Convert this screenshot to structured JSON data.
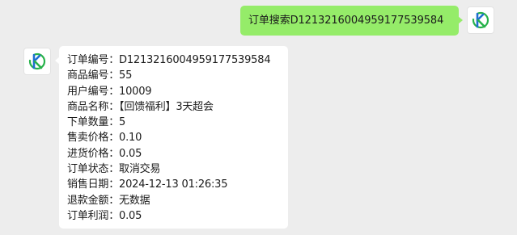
{
  "chat": {
    "outgoing": {
      "text": "订单搜索D1213216004959177539584"
    },
    "reply": {
      "lines": [
        {
          "label": "订单编号：",
          "value": "D1213216004959177539584"
        },
        {
          "label": "商品编号：",
          "value": "55"
        },
        {
          "label": "用户编号：",
          "value": "10009"
        },
        {
          "label": "商品名称：",
          "value": "【回馈福利】3天超会"
        },
        {
          "label": "下单数量：",
          "value": "5"
        },
        {
          "label": "售卖价格：",
          "value": "0.10"
        },
        {
          "label": "进货价格：",
          "value": "0.05"
        },
        {
          "label": "订单状态：",
          "value": "取消交易"
        },
        {
          "label": "销售日期：",
          "value": "2024-12-13 01:26:35"
        },
        {
          "label": "退款金额：",
          "value": "无数据"
        },
        {
          "label": "订单利润：",
          "value": "0.05"
        }
      ]
    }
  },
  "colors": {
    "background": "#ededed",
    "outgoing_bubble": "#95ec69",
    "incoming_bubble": "#ffffff",
    "logo_blue": "#1e6fd1",
    "logo_green": "#27b24a"
  },
  "icons": {
    "user_avatar": "brand-logo-icon",
    "bot_avatar": "brand-logo-icon"
  }
}
